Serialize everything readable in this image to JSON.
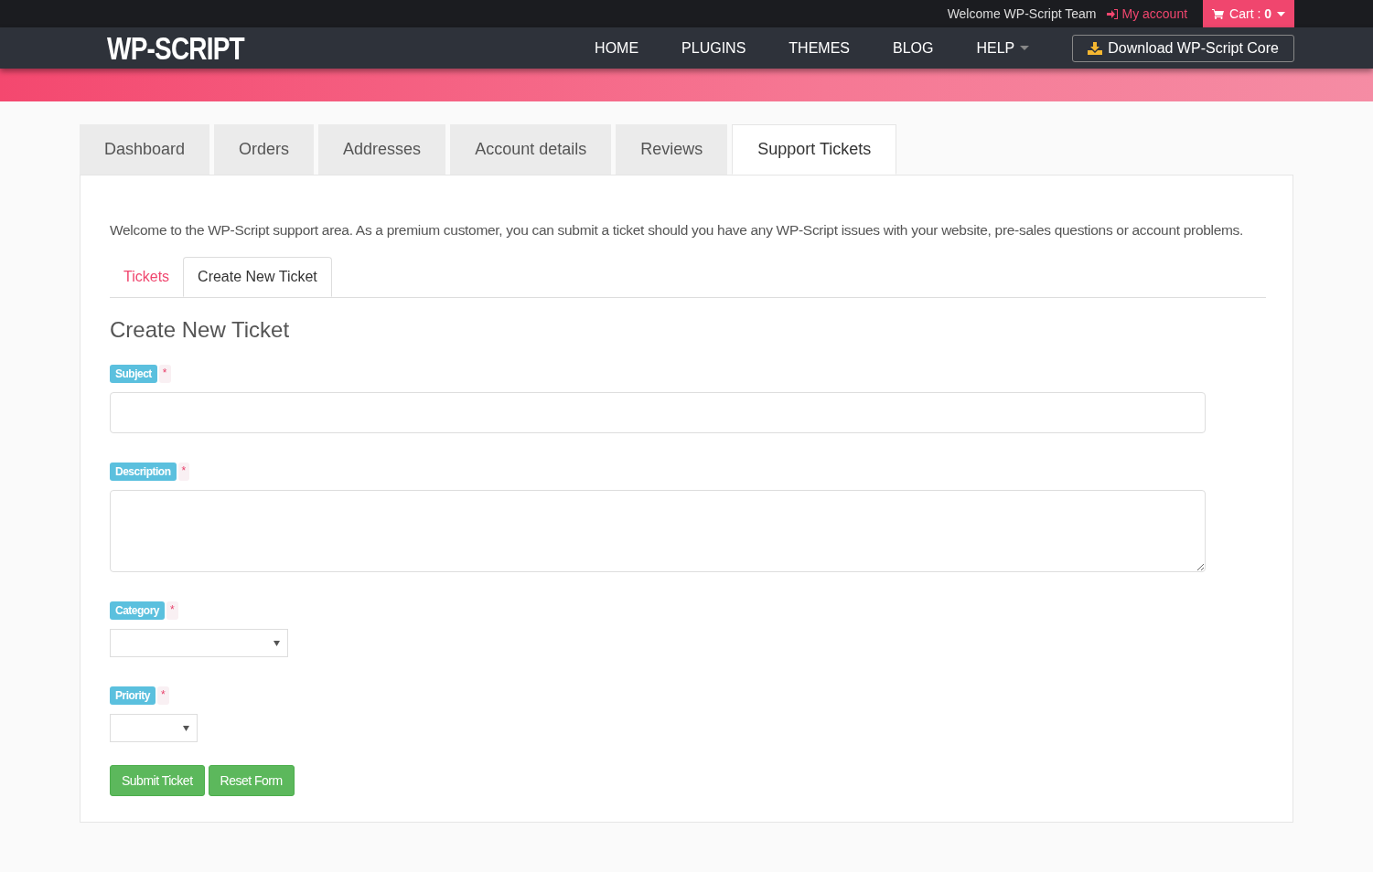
{
  "topbar": {
    "welcome": "Welcome WP-Script Team",
    "account_link": "My account",
    "cart": "Cart : ",
    "cart_count": "0"
  },
  "nav": {
    "logo": "WP-SCRIPT",
    "items": [
      {
        "label": "HOME",
        "dropdown": false
      },
      {
        "label": "PLUGINS",
        "dropdown": false
      },
      {
        "label": "THEMES",
        "dropdown": false
      },
      {
        "label": "BLOG",
        "dropdown": false
      },
      {
        "label": "HELP",
        "dropdown": true
      }
    ],
    "download_button": "Download WP-Script Core"
  },
  "account_tabs": [
    {
      "label": "Dashboard",
      "selected": false
    },
    {
      "label": "Orders",
      "selected": false
    },
    {
      "label": "Addresses",
      "selected": false
    },
    {
      "label": "Account details",
      "selected": false
    },
    {
      "label": "Reviews",
      "selected": false
    },
    {
      "label": "Support Tickets",
      "selected": true
    }
  ],
  "intro": "Welcome to the WP-Script support area. As a premium customer, you can submit a ticket should you have any WP-Script issues with your website, pre-sales questions or account problems.",
  "ticket_tabs": [
    {
      "label": "Tickets",
      "selected": false
    },
    {
      "label": "Create New Ticket",
      "selected": true
    }
  ],
  "heading": "Create New Ticket",
  "fields": [
    {
      "label": "Subject",
      "required_mark": "*",
      "kind": "text"
    },
    {
      "label": "Description",
      "required_mark": "*",
      "kind": "textarea"
    },
    {
      "label": "Category",
      "required_mark": "*",
      "kind": "select"
    },
    {
      "label": "Priority",
      "required_mark": "*",
      "kind": "select"
    }
  ],
  "buttons": [
    "Submit Ticket",
    "Reset Form"
  ]
}
